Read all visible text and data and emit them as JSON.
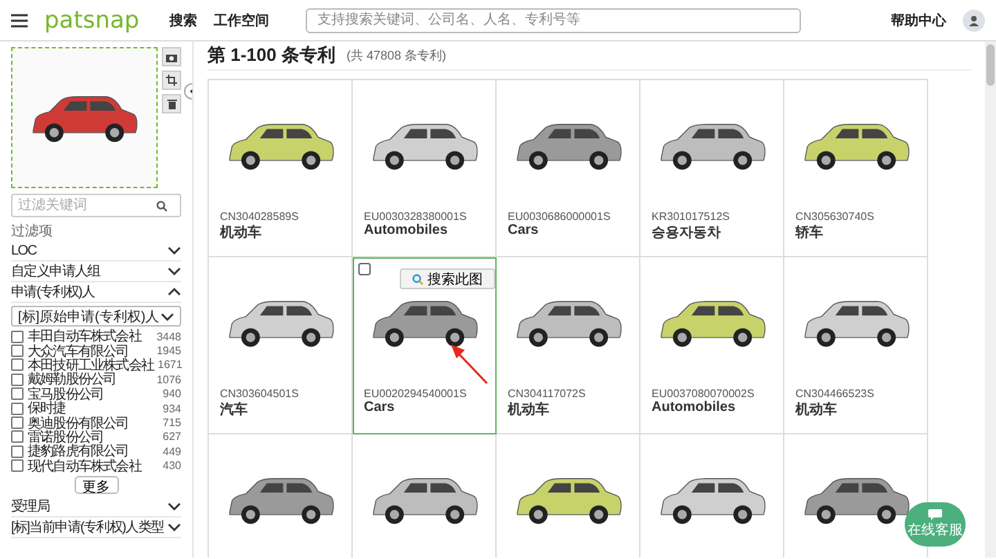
{
  "header": {
    "logo": "patsnap",
    "nav": [
      {
        "label": "搜索",
        "selected": false
      },
      {
        "label": "工作空间",
        "selected": false
      }
    ],
    "search": {
      "placeholder": "支持搜索关键词、公司名、人名、专利号等"
    },
    "help": "帮助中心"
  },
  "sidebar": {
    "filter_search": {
      "placeholder": "过滤关键词"
    },
    "filters_label": "过滤项",
    "sections": [
      {
        "title": "LOC",
        "expanded": false
      },
      {
        "title": "自定义申请人组",
        "expanded": false
      },
      {
        "title": "申请(专利权)人",
        "expanded": true,
        "dropdown": "[标]原始申请(专利权)人",
        "items": [
          {
            "name": "丰田自动车株式会社",
            "count": "3448",
            "checked": false
          },
          {
            "name": "大众汽车有限公司",
            "count": "1945",
            "checked": false
          },
          {
            "name": "本田技研工业株式会社",
            "count": "1671",
            "checked": false
          },
          {
            "name": "戴姆勒股份公司",
            "count": "1076",
            "checked": false
          },
          {
            "name": "宝马股份公司",
            "count": "940",
            "checked": false
          },
          {
            "name": "保时捷",
            "count": "934",
            "checked": false
          },
          {
            "name": "奥迪股份有限公司",
            "count": "715",
            "checked": false
          },
          {
            "name": "雷诺股份公司",
            "count": "627",
            "checked": false
          },
          {
            "name": "捷豹路虎有限公司",
            "count": "449",
            "checked": false
          },
          {
            "name": "现代自动车株式会社",
            "count": "430",
            "checked": false
          }
        ],
        "more": "更多"
      },
      {
        "title": "受理局",
        "expanded": false
      },
      {
        "title": "[标]当前申请(专利权)人类型",
        "expanded": false
      }
    ]
  },
  "results": {
    "title": "第 1-100 条专利",
    "total": "(共 47808 条专利)",
    "search_image_button": "搜索此图",
    "cells": [
      {
        "id": "CN304028589S",
        "title": "机动车",
        "selected": false
      },
      {
        "id": "EU0030328380001S",
        "title": "Automobiles",
        "selected": false
      },
      {
        "id": "EU0030686000001S",
        "title": "Cars",
        "selected": false
      },
      {
        "id": "KR301017512S",
        "title": "승용자동차",
        "selected": false
      },
      {
        "id": "CN305630740S",
        "title": "轿车",
        "selected": false
      },
      {
        "id": "CN303604501S",
        "title": "汽车",
        "selected": false
      },
      {
        "id": "EU0020294540001S",
        "title": "Cars",
        "selected": true
      },
      {
        "id": "CN304117072S",
        "title": "机动车",
        "selected": false
      },
      {
        "id": "EU0037080070002S",
        "title": "Automobiles",
        "selected": false
      },
      {
        "id": "CN304466523S",
        "title": "机动车",
        "selected": false
      },
      {
        "selected": false
      },
      {
        "selected": false
      },
      {
        "selected": false
      },
      {
        "selected": false
      },
      {
        "selected": false
      }
    ]
  },
  "chat_button": "在线客服"
}
